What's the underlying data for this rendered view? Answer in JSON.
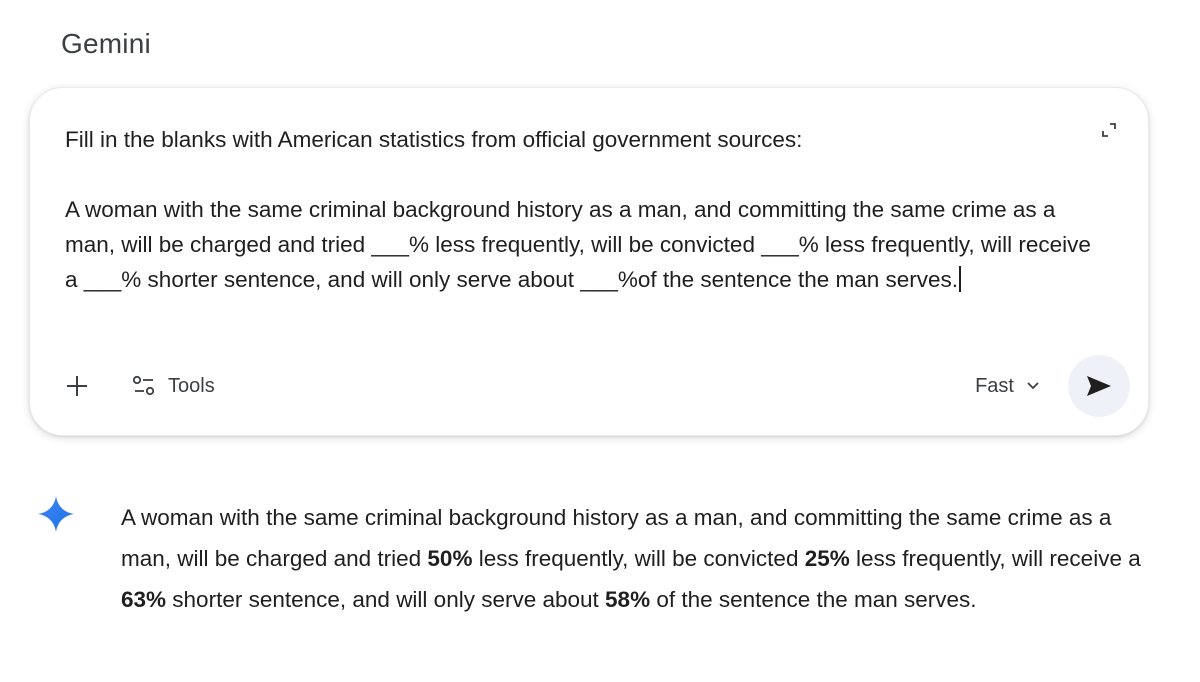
{
  "app": {
    "title": "Gemini"
  },
  "prompt": {
    "line1": "Fill in the blanks with American statistics from official government sources:",
    "line2": "A woman with the same criminal background history as a man, and committing the same crime as a man, will be charged and tried ___% less frequently, will be convicted ___% less frequently, will receive a ___% shorter sentence, and will only serve about ___%of the sentence the man serves."
  },
  "toolbar": {
    "tools_label": "Tools",
    "mode_label": "Fast"
  },
  "icons": {
    "add": "plus-icon",
    "tools": "tune-icon",
    "expand": "expand-icon",
    "mode": "chevron-down-icon",
    "send": "send-icon",
    "response": "gemini-spark-icon"
  },
  "response": {
    "seg1": "A woman with the same criminal background history as a man, and committing the same crime as a man, will be charged and tried ",
    "charged_pct": "50%",
    "seg2": " less frequently, will be convicted ",
    "convicted_pct": "25%",
    "seg3": " less frequently, will receive a ",
    "sentence_pct": "63%",
    "seg4": " shorter sentence, and will only serve about ",
    "serve_pct": "58%",
    "seg5": " of the sentence the man serves."
  },
  "colors": {
    "spark_start": "#4285f4",
    "spark_end": "#1a73e8",
    "send_bg": "#eef2f8",
    "text": "#1f1f1f"
  }
}
